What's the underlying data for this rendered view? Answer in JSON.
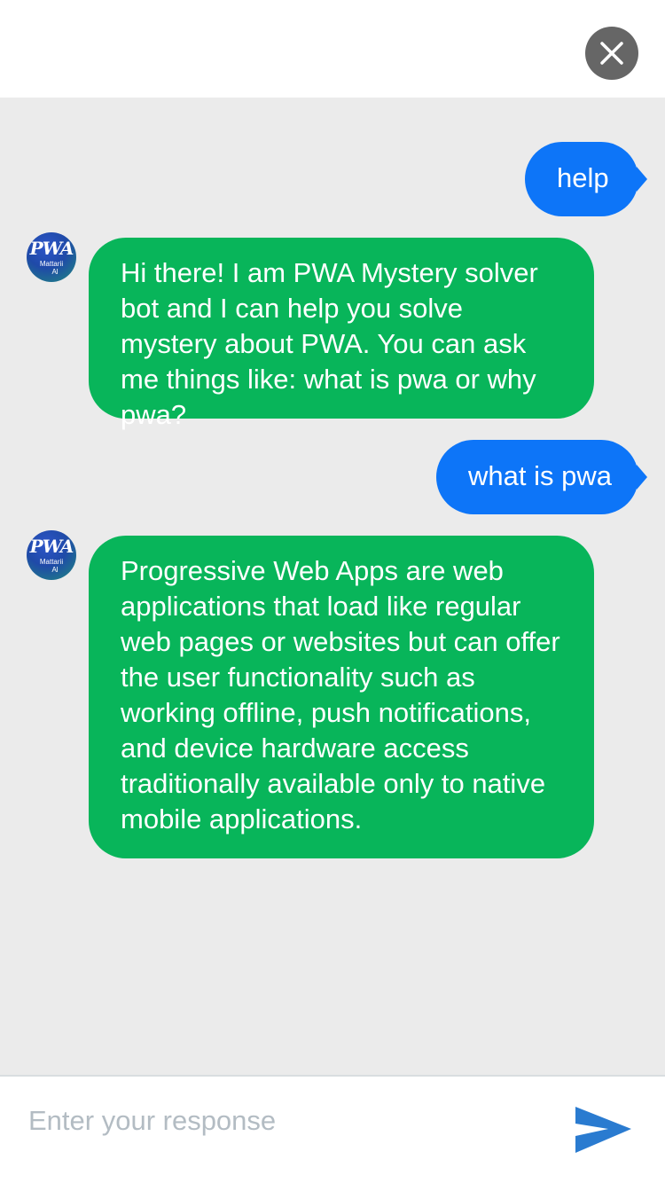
{
  "header": {
    "close_icon": "close-icon",
    "colors": {
      "close_bg": "#666666"
    }
  },
  "messages": [
    {
      "sender": "user",
      "text": "help"
    },
    {
      "sender": "bot",
      "avatar_text": "PWA",
      "avatar_sub1": "Mattarii",
      "avatar_sub2": "Al",
      "text": "Hi there! I am PWA Mystery solver bot and I can help you solve mystery about PWA. You can ask me things like: what is pwa or why pwa?"
    },
    {
      "sender": "user",
      "text": "what is pwa"
    },
    {
      "sender": "bot",
      "avatar_text": "PWA",
      "avatar_sub1": "Mattarii",
      "avatar_sub2": "Al",
      "text": "Progressive Web Apps are web applications that load like regular web pages or websites but can offer the user functionality such as working offline, push notifications, and device hardware access traditionally available only to native mobile applications."
    }
  ],
  "composer": {
    "placeholder": "Enter your response",
    "value": "",
    "send_icon": "send-icon"
  },
  "colors": {
    "user_bubble": "#0d75f8",
    "bot_bubble": "#08b55a",
    "chat_background": "#ebebeb",
    "send_icon": "#2a7bd0"
  }
}
